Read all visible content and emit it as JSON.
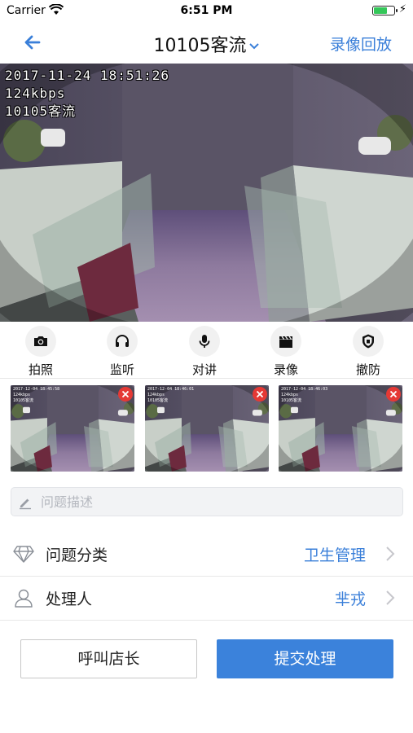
{
  "status_bar": {
    "carrier": "Carrier",
    "time": "6:51 PM",
    "battery_level": 0.7
  },
  "nav": {
    "back_icon": "arrow-left-icon",
    "title": "10105客流",
    "title_icon": "chevron-down-icon",
    "playback_label": "录像回放"
  },
  "video": {
    "osd_date": "2017-11-24 18:51:26",
    "osd_bitrate": "124kbps",
    "osd_channel": "10105客流"
  },
  "toolbar": [
    {
      "icon": "camera-icon",
      "label": "拍照"
    },
    {
      "icon": "headphones-icon",
      "label": "监听"
    },
    {
      "icon": "microphone-icon",
      "label": "对讲"
    },
    {
      "icon": "clapperboard-icon",
      "label": "录像"
    },
    {
      "icon": "shield-icon",
      "label": "撤防"
    }
  ],
  "thumbnails": [
    {
      "stamp": "2017-12-04 18:45:58\n124kbps\n10105客流"
    },
    {
      "stamp": "2017-12-04 18:46:01\n124kbps\n10105客流"
    },
    {
      "stamp": "2017-12-04 18:46:03\n124kbps\n10105客流"
    }
  ],
  "description": {
    "placeholder": "问题描述",
    "value": ""
  },
  "form": {
    "category": {
      "label": "问题分类",
      "value": "卫生管理",
      "icon": "diamond-icon"
    },
    "handler": {
      "label": "处理人",
      "value": "芈戎",
      "icon": "user-icon"
    }
  },
  "actions": {
    "call_label": "呼叫店长",
    "submit_label": "提交处理"
  },
  "colors": {
    "accent": "#3a7fd9",
    "submit_bg": "#3b82db",
    "delete_badge": "#e53935"
  }
}
